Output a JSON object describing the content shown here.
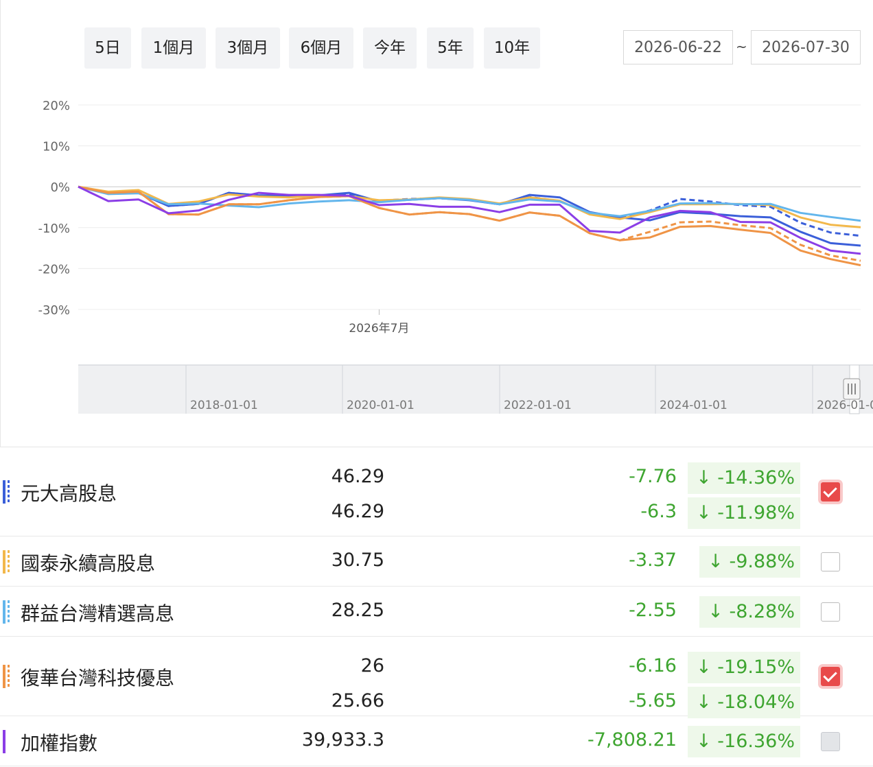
{
  "range_buttons": [
    "5日",
    "1個月",
    "3個月",
    "6個月",
    "今年",
    "5年",
    "10年"
  ],
  "date_range": {
    "start": "2026-06-22",
    "separator": "~",
    "end": "2026-07-30"
  },
  "chart_data": {
    "type": "line",
    "y_ticks": [
      "20%",
      "10%",
      "0%",
      "-10%",
      "-20%",
      "-30%"
    ],
    "y_tick_values": [
      20,
      10,
      0,
      -10,
      -20,
      -30
    ],
    "ylim": [
      -30,
      20
    ],
    "x_tick_label": "2026年7月",
    "x_tick_index": 10,
    "navigator_labels": [
      "2018-01-01",
      "2020-01-01",
      "2022-01-01",
      "2024-01-01",
      "2026-01-0"
    ],
    "grid": true,
    "series": [
      {
        "color": "#3b5fd9",
        "dashed": false,
        "values": [
          0,
          -1.5,
          -1.5,
          -4.7,
          -4.2,
          -1.5,
          -2.1,
          -2.2,
          -2.1,
          -1.5,
          -3.6,
          -3.2,
          -2.8,
          -3.3,
          -4.3,
          -2.0,
          -2.6,
          -6.2,
          -7.5,
          -8.2,
          -6.2,
          -6.6,
          -7.2,
          -7.5,
          -11.0,
          -13.8,
          -14.4
        ]
      },
      {
        "color": "#3b5fd9",
        "dashed": true,
        "values": [
          0,
          -1.5,
          -1.5,
          -4.7,
          -4.2,
          -1.5,
          -2.2,
          -2.5,
          -2.1,
          -2.0,
          -3.4,
          -3.0,
          -2.8,
          -3.2,
          -4.3,
          -2.5,
          -3.5,
          -6.5,
          -7.6,
          -5.8,
          -3.0,
          -3.6,
          -4.5,
          -4.9,
          -8.8,
          -11.2,
          -12.0
        ]
      },
      {
        "color": "#f2b84b",
        "dashed": false,
        "values": [
          0,
          -1.2,
          -0.8,
          -4.2,
          -3.6,
          -1.9,
          -2.4,
          -2.6,
          -2.2,
          -2.3,
          -3.3,
          -3.1,
          -2.6,
          -3.0,
          -4.1,
          -2.6,
          -3.4,
          -6.8,
          -7.9,
          -6.2,
          -4.3,
          -4.3,
          -4.2,
          -4.5,
          -7.5,
          -9.3,
          -9.9
        ]
      },
      {
        "color": "#63b6ec",
        "dashed": false,
        "values": [
          0,
          -1.8,
          -1.6,
          -4.3,
          -4.1,
          -4.6,
          -5.0,
          -4.1,
          -3.6,
          -3.3,
          -3.8,
          -3.2,
          -2.8,
          -3.2,
          -4.3,
          -3.1,
          -3.6,
          -6.4,
          -7.2,
          -5.9,
          -4.1,
          -4.0,
          -4.3,
          -4.2,
          -6.4,
          -7.4,
          -8.3
        ]
      },
      {
        "color": "#ef9446",
        "dashed": false,
        "values": [
          0,
          -1.5,
          -1.2,
          -6.7,
          -6.8,
          -4.3,
          -4.3,
          -3.3,
          -2.5,
          -2.3,
          -5.2,
          -6.8,
          -6.2,
          -6.7,
          -8.3,
          -6.3,
          -7.1,
          -11.4,
          -13.1,
          -12.4,
          -9.8,
          -9.6,
          -10.5,
          -11.3,
          -15.6,
          -17.7,
          -19.2
        ]
      },
      {
        "color": "#ef9446",
        "dashed": true,
        "values": [
          0,
          -1.5,
          -1.2,
          -6.7,
          -6.8,
          -4.3,
          -4.3,
          -3.3,
          -2.5,
          -2.3,
          -5.2,
          -6.8,
          -6.2,
          -6.7,
          -8.3,
          -6.3,
          -7.1,
          -11.4,
          -13.1,
          -11.0,
          -8.7,
          -8.5,
          -9.4,
          -10.1,
          -14.2,
          -16.8,
          -18.1
        ]
      },
      {
        "color": "#8b3ee6",
        "dashed": false,
        "values": [
          0,
          -3.5,
          -3.1,
          -6.5,
          -5.8,
          -3.2,
          -1.5,
          -2.0,
          -2.0,
          -2.2,
          -4.5,
          -4.2,
          -4.9,
          -4.9,
          -6.2,
          -4.4,
          -4.4,
          -10.8,
          -11.2,
          -7.5,
          -5.9,
          -6.2,
          -8.6,
          -8.7,
          -12.5,
          -15.6,
          -16.4
        ]
      }
    ]
  },
  "table": {
    "rows": [
      {
        "name": "元大高股息",
        "color": "#3b5fd9",
        "dashed": true,
        "checked": true,
        "disabled": false,
        "lines": [
          {
            "price": "46.29",
            "change": "-7.76",
            "pct": "-14.36%"
          },
          {
            "price": "46.29",
            "change": "-6.3",
            "pct": "-11.98%"
          }
        ]
      },
      {
        "name": "國泰永續高股息",
        "color": "#f2b84b",
        "dashed": true,
        "checked": false,
        "disabled": false,
        "lines": [
          {
            "price": "30.75",
            "change": "-3.37",
            "pct": "-9.88%"
          }
        ]
      },
      {
        "name": "群益台灣精選高息",
        "color": "#63b6ec",
        "dashed": true,
        "checked": false,
        "disabled": false,
        "lines": [
          {
            "price": "28.25",
            "change": "-2.55",
            "pct": "-8.28%"
          }
        ]
      },
      {
        "name": "復華台灣科技優息",
        "color": "#ef9446",
        "dashed": true,
        "checked": true,
        "disabled": false,
        "lines": [
          {
            "price": "26",
            "change": "-6.16",
            "pct": "-19.15%"
          },
          {
            "price": "25.66",
            "change": "-5.65",
            "pct": "-18.04%"
          }
        ]
      },
      {
        "name": "加權指數",
        "color": "#8b3ee6",
        "dashed": false,
        "checked": false,
        "disabled": true,
        "lines": [
          {
            "price": "39,933.3",
            "change": "-7,808.21",
            "pct": "-16.36%"
          }
        ]
      }
    ]
  }
}
